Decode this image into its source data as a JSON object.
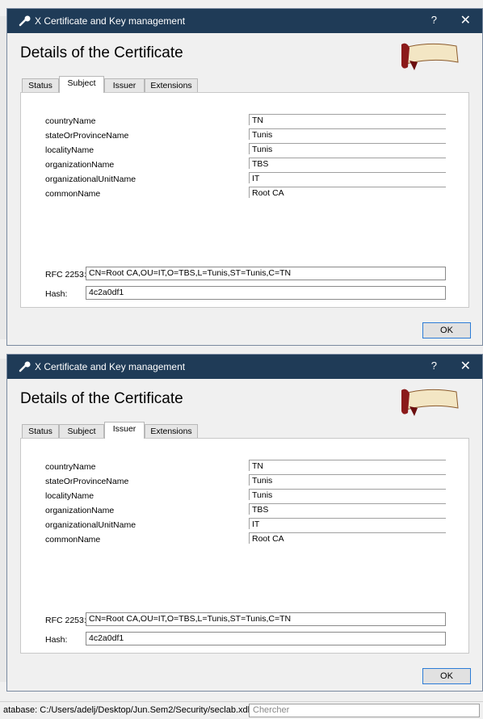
{
  "window": {
    "title": "X Certificate and Key management",
    "help": "?",
    "close": "✕"
  },
  "heading": "Details of the Certificate",
  "tabs": [
    "Status",
    "Subject",
    "Issuer",
    "Extensions"
  ],
  "dialogs": [
    {
      "active_tab": "Subject"
    },
    {
      "active_tab": "Issuer"
    }
  ],
  "fields": [
    {
      "label": "countryName",
      "value": "TN"
    },
    {
      "label": "stateOrProvinceName",
      "value": "Tunis"
    },
    {
      "label": "localityName",
      "value": "Tunis"
    },
    {
      "label": "organizationName",
      "value": "TBS"
    },
    {
      "label": "organizationalUnitName",
      "value": "IT"
    },
    {
      "label": "commonName",
      "value": "Root CA"
    }
  ],
  "rfc": {
    "label": "RFC 2253:",
    "value": "CN=Root CA,OU=IT,O=TBS,L=Tunis,ST=Tunis,C=TN"
  },
  "hash": {
    "label": "Hash:",
    "value": "4c2a0df1"
  },
  "ok_label": "OK",
  "statusbar": {
    "text": "atabase: C:/Users/adelj/Desktop/Jun.Sem2/Security/seclab.xdb",
    "search_placeholder": "Chercher"
  },
  "colors": {
    "titlebar": "#1f3b57",
    "ok_border": "#2c7cd6"
  }
}
